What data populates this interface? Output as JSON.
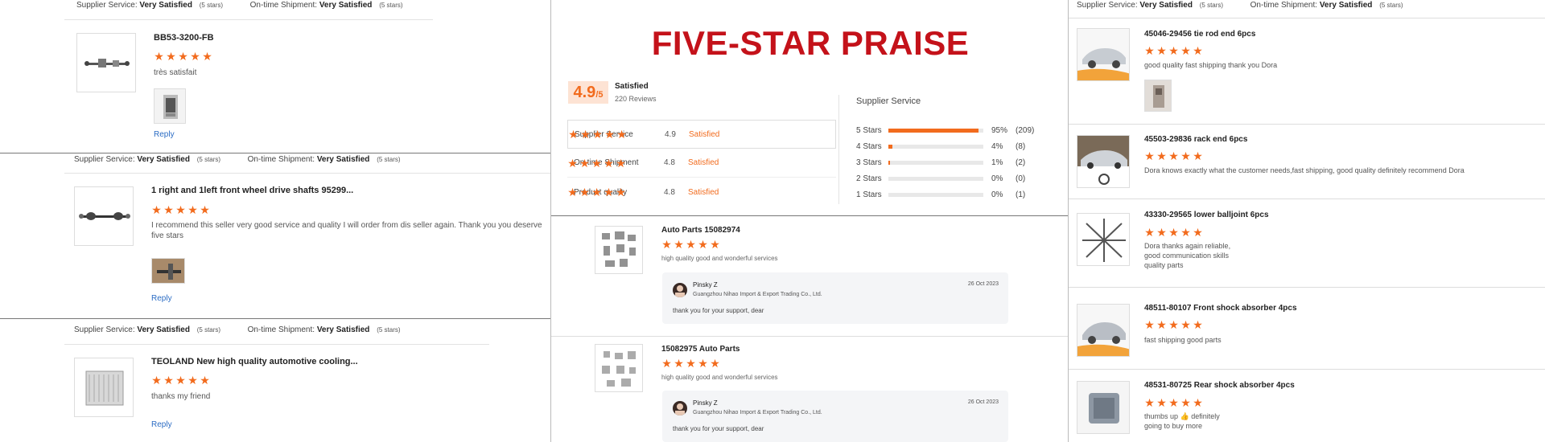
{
  "left_panel": {
    "labels": {
      "supplier_service": "Supplier Service:",
      "ontime_shipment": "On-time Shipment:",
      "very_satisfied": "Very Satisfied",
      "five_stars": "(5 stars)",
      "reply": "Reply"
    },
    "reviews": [
      {
        "title": "BB53-3200-FB",
        "text": "très satisfait"
      },
      {
        "title": "1 right and 1left front wheel drive shafts 95299...",
        "text": "I recommend this seller very good service and quality I will order from dis seller again. Thank you you deserve five stars"
      },
      {
        "title": "TEOLAND New high quality automotive cooling...",
        "text": "thanks my friend"
      }
    ]
  },
  "middle_panel": {
    "banner": "FIVE-STAR PRAISE",
    "score": "4.9",
    "score_den": "/5",
    "satisfaction": "Satisfied",
    "review_count": "220 Reviews",
    "metrics": [
      {
        "name": "Supplier Service",
        "score": "4.9",
        "status": "Satisfied"
      },
      {
        "name": "On-time Shipment",
        "score": "4.8",
        "status": "Satisfied"
      },
      {
        "name": "Product quality",
        "score": "4.8",
        "status": "Satisfied"
      }
    ],
    "distribution_title": "Supplier Service",
    "distribution": [
      {
        "label": "5 Stars",
        "pct": "95%",
        "count": "(209)",
        "value": 95
      },
      {
        "label": "4 Stars",
        "pct": "4%",
        "count": "(8)",
        "value": 4
      },
      {
        "label": "3 Stars",
        "pct": "1%",
        "count": "(2)",
        "value": 1
      },
      {
        "label": "2 Stars",
        "pct": "0%",
        "count": "(0)",
        "value": 0
      },
      {
        "label": "1 Stars",
        "pct": "0%",
        "count": "(1)",
        "value": 0
      }
    ],
    "reviews": [
      {
        "title": "Auto Parts 15082974",
        "text": "high quality good and wonderful services",
        "reply_name": "Pinsky Z",
        "reply_company": "Guangzhou Nihao Import & Export Trading Co., Ltd.",
        "reply_date": "26 Oct 2023",
        "reply_text": "thank  you for your support, dear"
      },
      {
        "title": "15082975 Auto Parts",
        "text": "high quality good and wonderful services",
        "reply_name": "Pinsky Z",
        "reply_company": "Guangzhou Nihao Import & Export Trading Co., Ltd.",
        "reply_date": "26 Oct 2023",
        "reply_text": "thank  you for your support, dear"
      }
    ]
  },
  "right_panel": {
    "labels": {
      "supplier_service": "Supplier Service:",
      "ontime_shipment": "On-time Shipment:",
      "very_satisfied": "Very Satisfied",
      "five_stars": "(5 stars)"
    },
    "reviews": [
      {
        "title": "45046-29456 tie rod end 6pcs",
        "text": "good quality fast shipping thank you Dora"
      },
      {
        "title": "45503-29836 rack end 6pcs",
        "text": "Dora knows exactly what the customer needs,fast shipping, good quality definitely recommend Dora"
      },
      {
        "title": "43330-29565 lower balljoint 6pcs",
        "text_lines": [
          "Dora thanks again reliable,",
          "good communication skills",
          "quality parts"
        ]
      },
      {
        "title": "48511-80107 Front shock absorber 4pcs",
        "text": "fast  shipping good parts"
      },
      {
        "title": "48531-80725 Rear shock absorber 4pcs",
        "text_lines": [
          "thumbs up 👍 definitely",
          "going to buy more"
        ]
      }
    ]
  },
  "colors": {
    "star": "#f26b1d",
    "banner": "#c4121a",
    "link": "#2b6cc4",
    "score_bg": "#fde3d4"
  }
}
